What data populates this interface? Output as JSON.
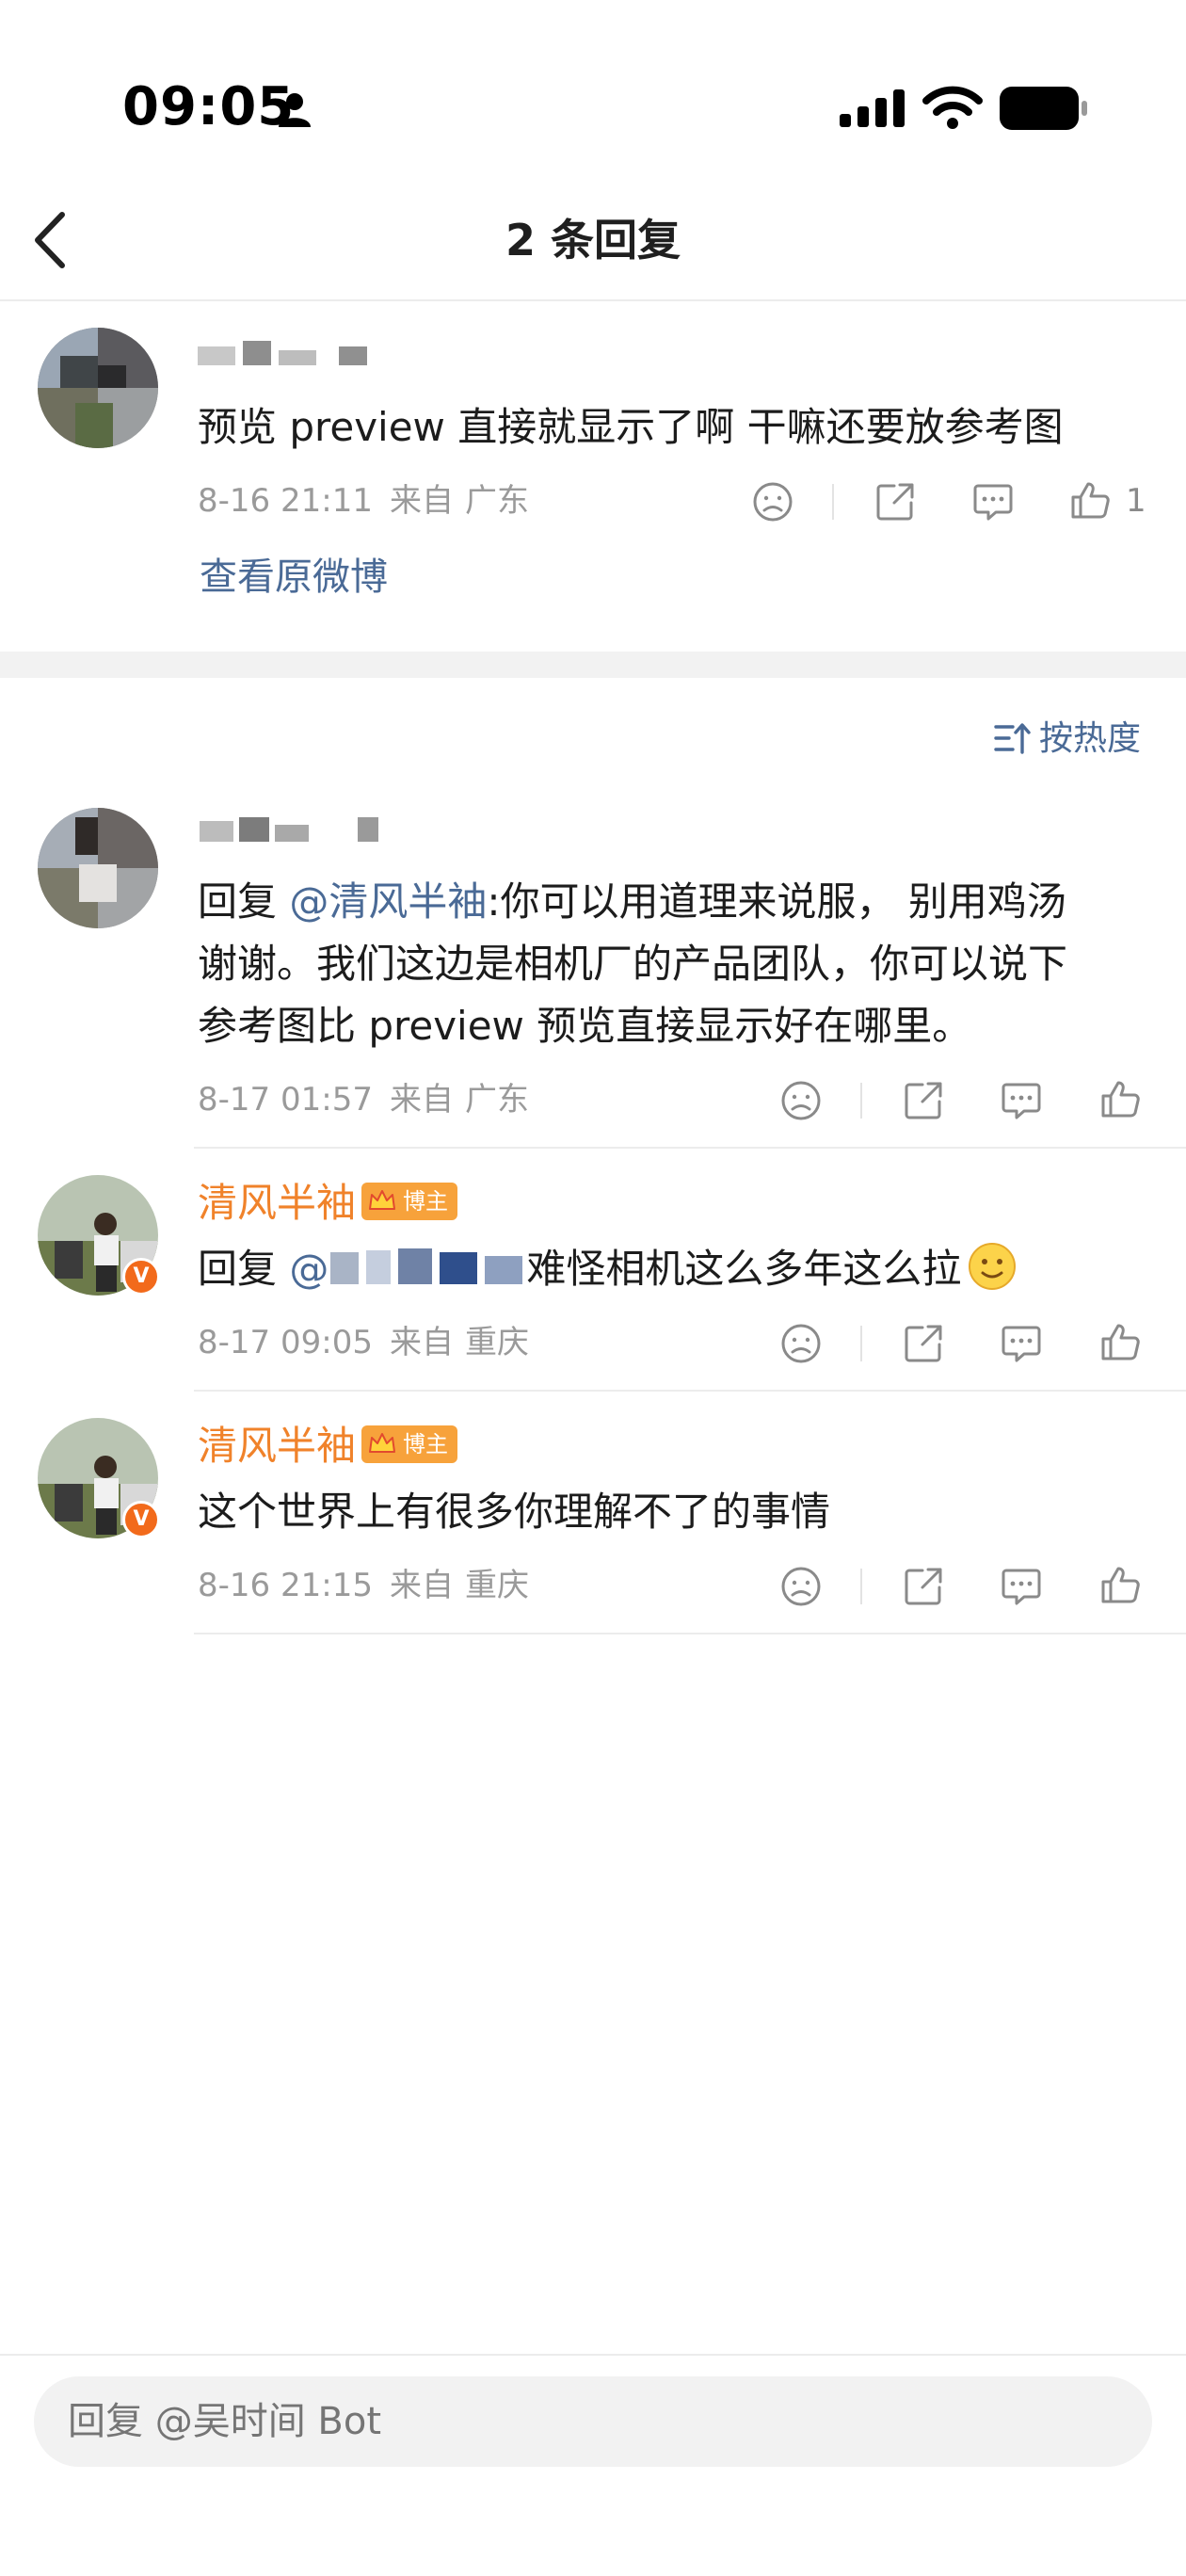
{
  "status_bar": {
    "time": "09:05"
  },
  "header": {
    "title": "2 条回复"
  },
  "original_comment": {
    "text": "预览 preview 直接就显示了啊 干嘛还要放参考图",
    "date": "8-16 21:11",
    "from_label": "来自",
    "location": "广东",
    "like_count": "1",
    "view_link": "查看原微博"
  },
  "sort": {
    "label": "按热度"
  },
  "replies": [
    {
      "reply_prefix": "回复",
      "mention": "@清风半袖",
      "line1": ":你可以用道理来说服， 别用鸡汤",
      "line2": "谢谢。我们这边是相机厂的产品团队，你可以说下",
      "line3": "参考图比 preview 预览直接显示好在哪里。",
      "date": "8-17 01:57",
      "from_label": "来自",
      "location": "广东"
    },
    {
      "username": "清风半袖",
      "badge": "博主",
      "reply_prefix": "回复",
      "mention": "@",
      "text": "难怪相机这么多年这么拉",
      "date": "8-17 09:05",
      "from_label": "来自",
      "location": "重庆"
    },
    {
      "username": "清风半袖",
      "badge": "博主",
      "text": "这个世界上有很多你理解不了的事情",
      "date": "8-16 21:15",
      "from_label": "来自",
      "location": "重庆"
    }
  ],
  "reply_input": {
    "placeholder": "回复 @吴时间 Bot"
  },
  "colors": {
    "accent": "#4a6a96",
    "username": "#f0822a",
    "verified": "#f26a1b",
    "badge": "#f7a23b"
  }
}
